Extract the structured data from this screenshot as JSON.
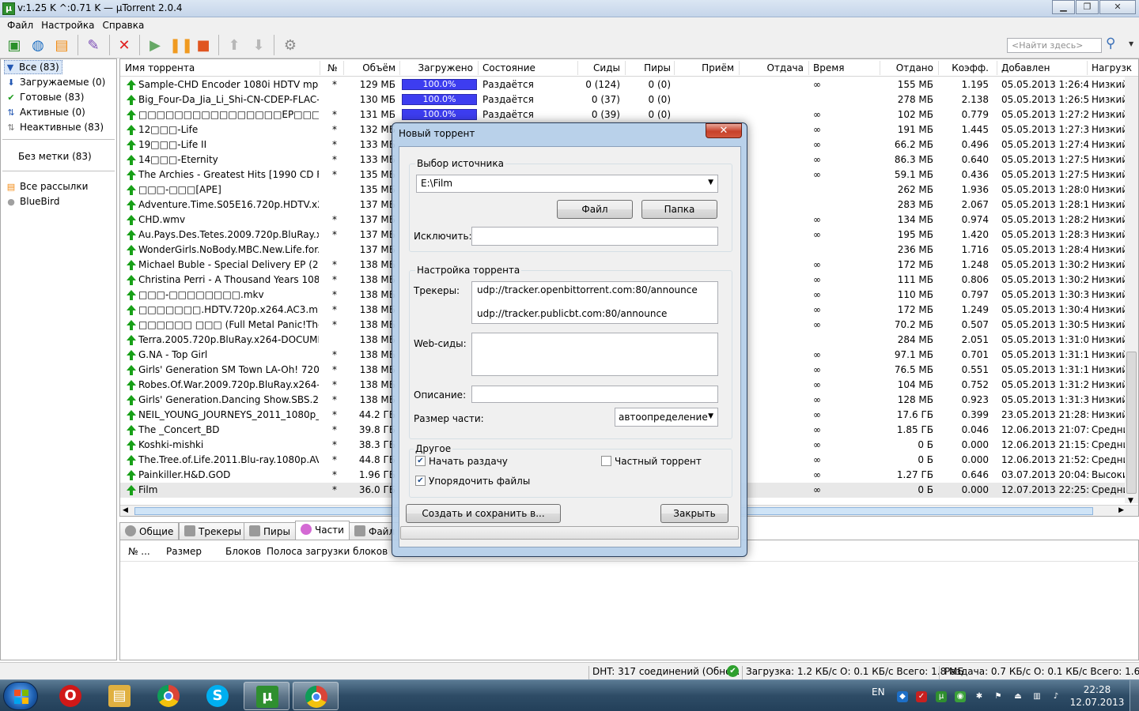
{
  "window": {
    "title": "v:1.25 K ^:0.71 K — µTorrent 2.0.4",
    "icon_letter": "µ"
  },
  "menu": [
    "Файл",
    "Настройка",
    "Справка"
  ],
  "search": {
    "placeholder": "<Найти здесь>"
  },
  "sidebar": {
    "items": [
      {
        "label": "Все (83)",
        "icon": "▼",
        "color": "#2458b3"
      },
      {
        "label": "Загружаемые (0)",
        "icon": "⬇",
        "color": "#2458b3"
      },
      {
        "label": "Готовые (83)",
        "icon": "✔",
        "color": "#1a9a1a"
      },
      {
        "label": "Активные (0)",
        "icon": "⇅",
        "color": "#2458b3"
      },
      {
        "label": "Неактивные (83)",
        "icon": "⇅",
        "color": "#7a7a7a"
      }
    ],
    "label_item": "Без метки (83)",
    "feeds": [
      {
        "label": "Все рассылки",
        "icon": "▤",
        "color": "#f28a12"
      },
      {
        "label": "BlueBird",
        "icon": "●",
        "color": "#a0a0a0"
      }
    ]
  },
  "columns": [
    "Имя торрента",
    "№",
    "Объём",
    "Загружено",
    "Состояние",
    "Сиды",
    "Пиры",
    "Приём",
    "Отдача",
    "Время",
    "Отдано",
    "Коэфф.",
    "Добавлен",
    "Нагрузк"
  ],
  "torrents": [
    {
      "name": "Sample-CHD Encoder 1080i HDTV mpeg...",
      "num": "*",
      "size": "129 МБ",
      "done": "100.0%",
      "status": "Раздаётся",
      "seeds": "0 (124)",
      "peers": "0 (0)",
      "time": "∞",
      "uploaded": "155 МБ",
      "ratio": "1.195",
      "added": "05.05.2013 1:26:48",
      "priority": "Низкий"
    },
    {
      "name": "Big_Four-Da_Jia_Li_Shi-CN-CDEP-FLAC-...",
      "num": "",
      "size": "130 МБ",
      "done": "100.0%",
      "status": "Раздаётся",
      "seeds": "0 (37)",
      "peers": "0 (0)",
      "time": "",
      "uploaded": "278 МБ",
      "ratio": "2.138",
      "added": "05.05.2013 1:26:55",
      "priority": "Низкий"
    },
    {
      "name": "□□□□□□□□□□□□□□□□EP□□□□□□□",
      "num": "*",
      "size": "131 МБ",
      "done": "100.0%",
      "status": "Раздаётся",
      "seeds": "0 (39)",
      "peers": "0 (0)",
      "time": "∞",
      "uploaded": "102 МБ",
      "ratio": "0.779",
      "added": "05.05.2013 1:27:28",
      "priority": "Низкий"
    },
    {
      "name": "12□□□-Life",
      "num": "*",
      "size": "132 МБ",
      "done": "",
      "status": "",
      "seeds": "",
      "peers": "",
      "time": "∞",
      "uploaded": "191 МБ",
      "ratio": "1.445",
      "added": "05.05.2013 1:27:36",
      "priority": "Низкий"
    },
    {
      "name": "19□□□-Life II",
      "num": "*",
      "size": "133 МБ",
      "done": "",
      "status": "",
      "seeds": "",
      "peers": "",
      "time": "∞",
      "uploaded": "66.2 МБ",
      "ratio": "0.496",
      "added": "05.05.2013 1:27:43",
      "priority": "Низкий"
    },
    {
      "name": "14□□□-Eternity",
      "num": "*",
      "size": "133 МБ",
      "done": "",
      "status": "",
      "seeds": "",
      "peers": "",
      "time": "∞",
      "uploaded": "86.3 МБ",
      "ratio": "0.640",
      "added": "05.05.2013 1:27:51",
      "priority": "Низкий"
    },
    {
      "name": "The Archies - Greatest Hits [1990 CD FLA...",
      "num": "*",
      "size": "135 МБ",
      "done": "",
      "status": "",
      "seeds": "",
      "peers": "",
      "time": "∞",
      "uploaded": "59.1 МБ",
      "ratio": "0.436",
      "added": "05.05.2013 1:27:58",
      "priority": "Низкий"
    },
    {
      "name": "□□□-□□□[APE]",
      "num": "",
      "size": "135 МБ",
      "done": "",
      "status": "",
      "seeds": "",
      "peers": "",
      "time": "",
      "uploaded": "262 МБ",
      "ratio": "1.936",
      "added": "05.05.2013 1:28:08",
      "priority": "Низкий"
    },
    {
      "name": "Adventure.Time.S05E16.720p.HDTV.x264...",
      "num": "",
      "size": "137 МБ",
      "done": "",
      "status": "",
      "seeds": "",
      "peers": "",
      "time": "",
      "uploaded": "283 МБ",
      "ratio": "2.067",
      "added": "05.05.2013 1:28:19",
      "priority": "Низкий"
    },
    {
      "name": "CHD.wmv",
      "num": "*",
      "size": "137 МБ",
      "done": "",
      "status": "",
      "seeds": "",
      "peers": "",
      "time": "∞",
      "uploaded": "134 МБ",
      "ratio": "0.974",
      "added": "05.05.2013 1:28:26",
      "priority": "Низкий"
    },
    {
      "name": "Au.Pays.Des.Tetes.2009.720p.BluRay.x264...",
      "num": "*",
      "size": "137 МБ",
      "done": "",
      "status": "",
      "seeds": "",
      "peers": "",
      "time": "∞",
      "uploaded": "195 МБ",
      "ratio": "1.420",
      "added": "05.05.2013 1:28:34",
      "priority": "Низкий"
    },
    {
      "name": "WonderGirls.NoBody.MBC.New.Life.for....",
      "num": "",
      "size": "137 МБ",
      "done": "",
      "status": "",
      "seeds": "",
      "peers": "",
      "time": "",
      "uploaded": "236 МБ",
      "ratio": "1.716",
      "added": "05.05.2013 1:28:41",
      "priority": "Низкий"
    },
    {
      "name": "Michael Buble - Special Delivery EP (2010...",
      "num": "*",
      "size": "138 МБ",
      "done": "",
      "status": "",
      "seeds": "",
      "peers": "",
      "time": "∞",
      "uploaded": "172 МБ",
      "ratio": "1.248",
      "added": "05.05.2013 1:30:21",
      "priority": "Низкий"
    },
    {
      "name": "Christina Perri - A Thousand Years 1080p...",
      "num": "*",
      "size": "138 МБ",
      "done": "",
      "status": "",
      "seeds": "",
      "peers": "",
      "time": "∞",
      "uploaded": "111 МБ",
      "ratio": "0.806",
      "added": "05.05.2013 1:30:29",
      "priority": "Низкий"
    },
    {
      "name": "□□□-□□□□□□□□.mkv",
      "num": "*",
      "size": "138 МБ",
      "done": "",
      "status": "",
      "seeds": "",
      "peers": "",
      "time": "∞",
      "uploaded": "110 МБ",
      "ratio": "0.797",
      "added": "05.05.2013 1:30:37",
      "priority": "Низкий"
    },
    {
      "name": "□□□□□□□.HDTV.720p.x264.AC3.mkv",
      "num": "*",
      "size": "138 МБ",
      "done": "",
      "status": "",
      "seeds": "",
      "peers": "",
      "time": "∞",
      "uploaded": "172 МБ",
      "ratio": "1.249",
      "added": "05.05.2013 1:30:45",
      "priority": "Низкий"
    },
    {
      "name": "□□□□□□ □□□ (Full Metal Panic!The Sec...",
      "num": "*",
      "size": "138 МБ",
      "done": "",
      "status": "",
      "seeds": "",
      "peers": "",
      "time": "∞",
      "uploaded": "70.2 МБ",
      "ratio": "0.507",
      "added": "05.05.2013 1:30:53",
      "priority": "Низкий"
    },
    {
      "name": "Terra.2005.720p.BluRay.x264-DOCUMENT",
      "num": "",
      "size": "138 МБ",
      "done": "",
      "status": "",
      "seeds": "",
      "peers": "",
      "time": "",
      "uploaded": "284 МБ",
      "ratio": "2.051",
      "added": "05.05.2013 1:31:00",
      "priority": "Низкий"
    },
    {
      "name": "G.NA - Top Girl",
      "num": "*",
      "size": "138 МБ",
      "done": "",
      "status": "",
      "seeds": "",
      "peers": "",
      "time": "∞",
      "uploaded": "97.1 МБ",
      "ratio": "0.701",
      "added": "05.05.2013 1:31:10",
      "priority": "Низкий"
    },
    {
      "name": "Girls' Generation SM Town LA-Oh! 720p ...",
      "num": "*",
      "size": "138 МБ",
      "done": "",
      "status": "",
      "seeds": "",
      "peers": "",
      "time": "∞",
      "uploaded": "76.5 МБ",
      "ratio": "0.551",
      "added": "05.05.2013 1:31:18",
      "priority": "Низкий"
    },
    {
      "name": "Robes.Of.War.2009.720p.BluRay.x264-DO...",
      "num": "*",
      "size": "138 МБ",
      "done": "",
      "status": "",
      "seeds": "",
      "peers": "",
      "time": "∞",
      "uploaded": "104 МБ",
      "ratio": "0.752",
      "added": "05.05.2013 1:31:28",
      "priority": "Низкий"
    },
    {
      "name": "Girls' Generation.Dancing Show.SBS.2010...",
      "num": "*",
      "size": "138 МБ",
      "done": "",
      "status": "",
      "seeds": "",
      "peers": "",
      "time": "∞",
      "uploaded": "128 МБ",
      "ratio": "0.923",
      "added": "05.05.2013 1:31:35",
      "priority": "Низкий"
    },
    {
      "name": "NEIL_YOUNG_JOURNEYS_2011_1080p_AV...",
      "num": "*",
      "size": "44.2 ГБ",
      "done": "",
      "status": "",
      "seeds": "",
      "peers": "",
      "time": "∞",
      "uploaded": "17.6 ГБ",
      "ratio": "0.399",
      "added": "23.05.2013 21:28:52",
      "priority": "Низкий"
    },
    {
      "name": "The _Concert_BD",
      "num": "*",
      "size": "39.8 ГБ",
      "done": "",
      "status": "",
      "seeds": "",
      "peers": "",
      "time": "∞",
      "uploaded": "1.85 ГБ",
      "ratio": "0.046",
      "added": "12.06.2013 21:07:40",
      "priority": "Средни"
    },
    {
      "name": "Koshki-mishki",
      "num": "*",
      "size": "38.3 ГБ",
      "done": "",
      "status": "",
      "seeds": "",
      "peers": "",
      "time": "∞",
      "uploaded": "0 Б",
      "ratio": "0.000",
      "added": "12.06.2013 21:15:53",
      "priority": "Средни"
    },
    {
      "name": "The.Tree.of.Life.2011.Blu-ray.1080p.AVC....",
      "num": "*",
      "size": "44.8 ГБ",
      "done": "",
      "status": "",
      "seeds": "",
      "peers": "",
      "time": "∞",
      "uploaded": "0 Б",
      "ratio": "0.000",
      "added": "12.06.2013 21:52:44",
      "priority": "Средни"
    },
    {
      "name": "Painkiller.H&D.GOD",
      "num": "*",
      "size": "1.96 ГБ",
      "done": "",
      "status": "",
      "seeds": "",
      "peers": "",
      "time": "∞",
      "uploaded": "1.27 ГБ",
      "ratio": "0.646",
      "added": "03.07.2013 20:04:20",
      "priority": "Высоки"
    },
    {
      "name": "Film",
      "num": "*",
      "size": "36.0 ГБ",
      "done": "",
      "status": "",
      "seeds": "",
      "peers": "",
      "time": "∞",
      "uploaded": "0 Б",
      "ratio": "0.000",
      "added": "12.07.2013 22:25:22",
      "priority": "Средни"
    }
  ],
  "tabs": [
    {
      "label": "Общие",
      "color": "#888888"
    },
    {
      "label": "Трекеры",
      "color": "#888888"
    },
    {
      "label": "Пиры",
      "color": "#888888"
    },
    {
      "label": "Части",
      "color": "#d46ad4"
    },
    {
      "label": "Файл",
      "color": "#888888"
    }
  ],
  "details_columns": [
    "№ ...",
    "Размер",
    "Блоков",
    "Полоса загрузки блоков"
  ],
  "status": {
    "dht": "DHT: 317 соединений  (Обнов.",
    "download": "Загрузка: 1.2 КБ/с О: 0.1 КБ/с Всего: 1.8 МБ",
    "upload": "Раздача: 0.7 КБ/с О: 0.1 КБ/с Всего: 1.6 МБ"
  },
  "dialog": {
    "title": "Новый торрент",
    "close": "✕",
    "source_group": "Выбор источника",
    "source_value": "E:\\Film",
    "file_button": "Файл",
    "folder_button": "Папка",
    "exclude_label": "Исключить:",
    "settings_group": "Настройка торрента",
    "trackers_label": "Трекеры:",
    "trackers": [
      "udp://tracker.openbittorrent.com:80/announce",
      "udp://tracker.publicbt.com:80/announce"
    ],
    "webseeds_label": "Web-сиды:",
    "description_label": "Описание:",
    "piece_label": "Размер части:",
    "piece_value": "автоопределение",
    "other_group": "Другое",
    "start_seeding": "Начать раздачу",
    "private_torrent": "Частный торрент",
    "preserve_order": "Упорядочить файлы",
    "create_button": "Создать и сохранить в...",
    "close_button": "Закрыть"
  },
  "taskbar": {
    "lang": "EN",
    "time": "22:28",
    "date": "12.07.2013"
  }
}
